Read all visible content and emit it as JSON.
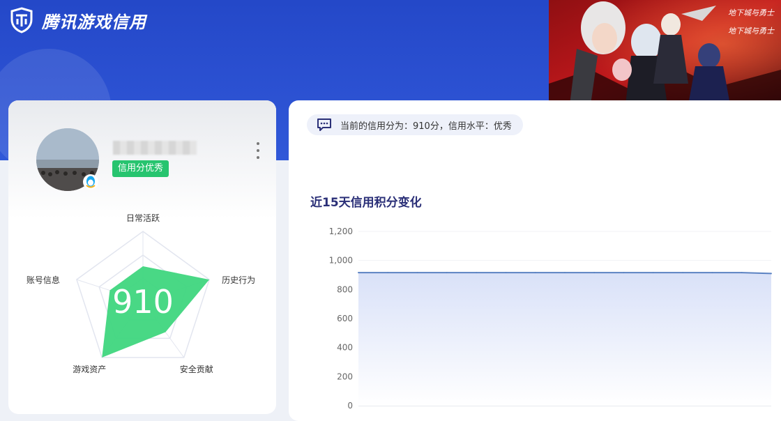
{
  "header": {
    "brand": "腾讯游戏信用",
    "accent": "#2448c8"
  },
  "banner": {
    "alt": "地下城与勇士",
    "game_logo_text": "地下城与勇士"
  },
  "profile": {
    "credit_badge": "信用分优秀",
    "score": "910",
    "more_icon": "more-vertical-icon",
    "qq_icon": "qq-penguin-icon"
  },
  "radar": {
    "axes": [
      "日常活跃",
      "历史行为",
      "安全贡献",
      "游戏资产",
      "账号信息"
    ],
    "values": [
      0.5,
      1.0,
      0.55,
      1.0,
      0.5
    ],
    "fill_color": "#3fd67e"
  },
  "status": {
    "icon": "message-icon",
    "text": "当前的信用分为：910分，信用水平：优秀"
  },
  "chart_data": {
    "type": "area",
    "title": "近15天信用积分变化",
    "xlabel": "",
    "ylabel": "",
    "ylim": [
      0,
      1200
    ],
    "yticks": [
      "0",
      "200",
      "400",
      "600",
      "800",
      "1,000",
      "1,200"
    ],
    "series": [
      {
        "values": [
          916,
          916,
          916,
          916,
          916,
          916,
          916,
          916,
          916,
          916,
          916,
          916,
          916,
          916,
          910
        ]
      }
    ],
    "grid": true,
    "line_color": "#5b82c2"
  }
}
